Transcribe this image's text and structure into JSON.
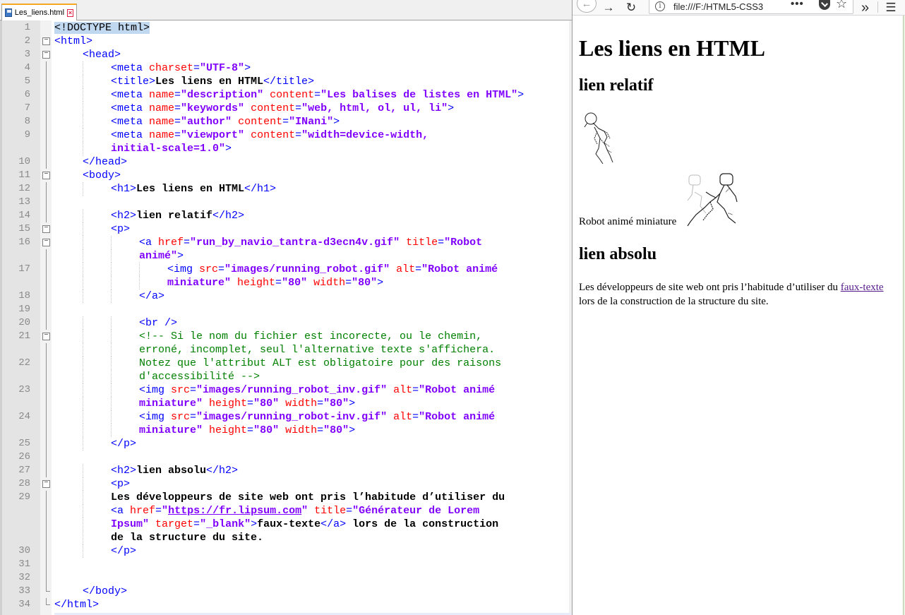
{
  "editor": {
    "tab_title": "Les_liens.html",
    "lines": [
      {
        "n": "1",
        "indent": 0,
        "fold": "",
        "segs": [
          [
            "dt",
            "<!DOCTYPE html>"
          ]
        ]
      },
      {
        "n": "2",
        "indent": 0,
        "fold": "minus",
        "segs": [
          [
            "tg",
            "<html>"
          ]
        ]
      },
      {
        "n": "3",
        "indent": 1,
        "fold": "minus",
        "segs": [
          [
            "tg",
            "<head>"
          ]
        ]
      },
      {
        "n": "4",
        "indent": 2,
        "fold": "line",
        "segs": [
          [
            "tg",
            "<meta "
          ],
          [
            "at",
            "charset"
          ],
          [
            "tg",
            "="
          ],
          [
            "av",
            "\"UTF-8\""
          ],
          [
            "tg",
            ">"
          ]
        ]
      },
      {
        "n": "5",
        "indent": 2,
        "fold": "line",
        "segs": [
          [
            "tg",
            "<title>"
          ],
          [
            "tx",
            "Les liens en HTML"
          ],
          [
            "tg",
            "</title>"
          ]
        ]
      },
      {
        "n": "6",
        "indent": 2,
        "fold": "line",
        "segs": [
          [
            "tg",
            "<meta "
          ],
          [
            "at",
            "name"
          ],
          [
            "tg",
            "="
          ],
          [
            "av",
            "\"description\""
          ],
          [
            "tg",
            " "
          ],
          [
            "at",
            "content"
          ],
          [
            "tg",
            "="
          ],
          [
            "av",
            "\"Les balises de listes en HTML\""
          ],
          [
            "tg",
            ">"
          ]
        ]
      },
      {
        "n": "7",
        "indent": 2,
        "fold": "line",
        "segs": [
          [
            "tg",
            "<meta "
          ],
          [
            "at",
            "name"
          ],
          [
            "tg",
            "="
          ],
          [
            "av",
            "\"keywords\""
          ],
          [
            "tg",
            " "
          ],
          [
            "at",
            "content"
          ],
          [
            "tg",
            "="
          ],
          [
            "av",
            "\"web, html, ol, ul, li\""
          ],
          [
            "tg",
            ">"
          ]
        ]
      },
      {
        "n": "8",
        "indent": 2,
        "fold": "line",
        "segs": [
          [
            "tg",
            "<meta "
          ],
          [
            "at",
            "name"
          ],
          [
            "tg",
            "="
          ],
          [
            "av",
            "\"author\""
          ],
          [
            "tg",
            " "
          ],
          [
            "at",
            "content"
          ],
          [
            "tg",
            "="
          ],
          [
            "av",
            "\"INani\""
          ],
          [
            "tg",
            ">"
          ]
        ]
      },
      {
        "n": "9",
        "indent": 2,
        "fold": "line",
        "segs": [
          [
            "tg",
            "<meta "
          ],
          [
            "at",
            "name"
          ],
          [
            "tg",
            "="
          ],
          [
            "av",
            "\"viewport\""
          ],
          [
            "tg",
            " "
          ],
          [
            "at",
            "content"
          ],
          [
            "tg",
            "="
          ],
          [
            "av",
            "\"width=device-width,"
          ]
        ]
      },
      {
        "n": "",
        "indent": 2,
        "fold": "line",
        "segs": [
          [
            "av",
            "initial-scale=1.0\""
          ],
          [
            "tg",
            ">"
          ]
        ]
      },
      {
        "n": "10",
        "indent": 1,
        "fold": "line",
        "segs": [
          [
            "tg",
            "</head>"
          ]
        ]
      },
      {
        "n": "11",
        "indent": 1,
        "fold": "minus",
        "segs": [
          [
            "tg",
            "<body>"
          ]
        ]
      },
      {
        "n": "12",
        "indent": 2,
        "fold": "line",
        "segs": [
          [
            "tg",
            "<h1>"
          ],
          [
            "tx",
            "Les liens en HTML"
          ],
          [
            "tg",
            "</h1>"
          ]
        ]
      },
      {
        "n": "13",
        "indent": 0,
        "fold": "line",
        "segs": []
      },
      {
        "n": "14",
        "indent": 2,
        "fold": "line",
        "segs": [
          [
            "tg",
            "<h2>"
          ],
          [
            "tx",
            "lien relatif"
          ],
          [
            "tg",
            "</h2>"
          ]
        ]
      },
      {
        "n": "15",
        "indent": 2,
        "fold": "minus",
        "segs": [
          [
            "tg",
            "<p>"
          ]
        ]
      },
      {
        "n": "16",
        "indent": 3,
        "fold": "minus",
        "segs": [
          [
            "tg",
            "<a "
          ],
          [
            "at",
            "href"
          ],
          [
            "tg",
            "="
          ],
          [
            "av",
            "\"run_by_navio_tantra-d3ecn4v.gif\""
          ],
          [
            "tg",
            " "
          ],
          [
            "at",
            "title"
          ],
          [
            "tg",
            "="
          ],
          [
            "av",
            "\"Robot"
          ]
        ]
      },
      {
        "n": "",
        "indent": 3,
        "fold": "line",
        "segs": [
          [
            "av",
            "animé\""
          ],
          [
            "tg",
            ">"
          ]
        ]
      },
      {
        "n": "17",
        "indent": 4,
        "fold": "line",
        "segs": [
          [
            "tg",
            "<img "
          ],
          [
            "at",
            "src"
          ],
          [
            "tg",
            "="
          ],
          [
            "av",
            "\"images/running_robot.gif\""
          ],
          [
            "tg",
            " "
          ],
          [
            "at",
            "alt"
          ],
          [
            "tg",
            "="
          ],
          [
            "av",
            "\"Robot animé"
          ]
        ]
      },
      {
        "n": "",
        "indent": 4,
        "fold": "line",
        "segs": [
          [
            "av",
            "miniature\""
          ],
          [
            "tg",
            " "
          ],
          [
            "at",
            "height"
          ],
          [
            "tg",
            "="
          ],
          [
            "av",
            "\"80\""
          ],
          [
            "tg",
            " "
          ],
          [
            "at",
            "width"
          ],
          [
            "tg",
            "="
          ],
          [
            "av",
            "\"80\""
          ],
          [
            "tg",
            ">"
          ]
        ]
      },
      {
        "n": "18",
        "indent": 3,
        "fold": "line",
        "segs": [
          [
            "tg",
            "</a>"
          ]
        ]
      },
      {
        "n": "19",
        "indent": 0,
        "fold": "line",
        "segs": []
      },
      {
        "n": "20",
        "indent": 3,
        "fold": "line",
        "segs": [
          [
            "tg",
            "<br />"
          ]
        ]
      },
      {
        "n": "21",
        "indent": 3,
        "fold": "minus",
        "segs": [
          [
            "cm",
            "<!-- Si le nom du fichier est incorecte, ou le chemin,"
          ]
        ]
      },
      {
        "n": "",
        "indent": 3,
        "fold": "line",
        "segs": [
          [
            "cm",
            "erroné, incomplet, seul l'alternative texte s'affichera."
          ]
        ]
      },
      {
        "n": "22",
        "indent": 3,
        "fold": "line",
        "segs": [
          [
            "cm",
            "Notez que l'attribut ALT est obligatoire pour des raisons"
          ]
        ]
      },
      {
        "n": "",
        "indent": 3,
        "fold": "line",
        "segs": [
          [
            "cm",
            "d'accessibilité -->"
          ]
        ]
      },
      {
        "n": "23",
        "indent": 3,
        "fold": "line",
        "segs": [
          [
            "tg",
            "<img "
          ],
          [
            "at",
            "src"
          ],
          [
            "tg",
            "="
          ],
          [
            "av",
            "\"images/running_robot_inv.gif\""
          ],
          [
            "tg",
            " "
          ],
          [
            "at",
            "alt"
          ],
          [
            "tg",
            "="
          ],
          [
            "av",
            "\"Robot animé"
          ]
        ]
      },
      {
        "n": "",
        "indent": 3,
        "fold": "line",
        "segs": [
          [
            "av",
            "miniature\""
          ],
          [
            "tg",
            " "
          ],
          [
            "at",
            "height"
          ],
          [
            "tg",
            "="
          ],
          [
            "av",
            "\"80\""
          ],
          [
            "tg",
            " "
          ],
          [
            "at",
            "width"
          ],
          [
            "tg",
            "="
          ],
          [
            "av",
            "\"80\""
          ],
          [
            "tg",
            ">"
          ]
        ]
      },
      {
        "n": "24",
        "indent": 3,
        "fold": "line",
        "segs": [
          [
            "tg",
            "<img "
          ],
          [
            "at",
            "src"
          ],
          [
            "tg",
            "="
          ],
          [
            "av",
            "\"images/running_robot-inv.gif\""
          ],
          [
            "tg",
            " "
          ],
          [
            "at",
            "alt"
          ],
          [
            "tg",
            "="
          ],
          [
            "av",
            "\"Robot animé"
          ]
        ]
      },
      {
        "n": "",
        "indent": 3,
        "fold": "line",
        "segs": [
          [
            "av",
            "miniature\""
          ],
          [
            "tg",
            " "
          ],
          [
            "at",
            "height"
          ],
          [
            "tg",
            "="
          ],
          [
            "av",
            "\"80\""
          ],
          [
            "tg",
            " "
          ],
          [
            "at",
            "width"
          ],
          [
            "tg",
            "="
          ],
          [
            "av",
            "\"80\""
          ],
          [
            "tg",
            ">"
          ]
        ]
      },
      {
        "n": "25",
        "indent": 2,
        "fold": "line",
        "segs": [
          [
            "tg",
            "</p>"
          ]
        ]
      },
      {
        "n": "26",
        "indent": 0,
        "fold": "line",
        "segs": []
      },
      {
        "n": "27",
        "indent": 2,
        "fold": "line",
        "segs": [
          [
            "tg",
            "<h2>"
          ],
          [
            "tx",
            "lien absolu"
          ],
          [
            "tg",
            "</h2>"
          ]
        ]
      },
      {
        "n": "28",
        "indent": 2,
        "fold": "minus",
        "segs": [
          [
            "tg",
            "<p>"
          ]
        ]
      },
      {
        "n": "29",
        "indent": 2,
        "fold": "line",
        "segs": [
          [
            "tx",
            "Les développeurs de site web ont pris l’habitude d’utiliser du"
          ]
        ]
      },
      {
        "n": "",
        "indent": 2,
        "fold": "line",
        "segs": [
          [
            "tg",
            "<a "
          ],
          [
            "at",
            "href"
          ],
          [
            "tg",
            "="
          ],
          [
            "av",
            "\""
          ],
          [
            "avu",
            "https://fr.lipsum.com"
          ],
          [
            "av",
            "\""
          ],
          [
            "tg",
            " "
          ],
          [
            "at",
            "title"
          ],
          [
            "tg",
            "="
          ],
          [
            "av",
            "\"Générateur de Lorem"
          ]
        ]
      },
      {
        "n": "",
        "indent": 2,
        "fold": "line",
        "segs": [
          [
            "av",
            "Ipsum\""
          ],
          [
            "tg",
            " "
          ],
          [
            "at",
            "target"
          ],
          [
            "tg",
            "="
          ],
          [
            "av",
            "\"_blank\""
          ],
          [
            "tg",
            ">"
          ],
          [
            "tx",
            "faux-texte"
          ],
          [
            "tg",
            "</a>"
          ],
          [
            "tx",
            " lors de la construction"
          ]
        ]
      },
      {
        "n": "",
        "indent": 2,
        "fold": "line",
        "segs": [
          [
            "tx",
            "de la structure du site."
          ]
        ]
      },
      {
        "n": "30",
        "indent": 2,
        "fold": "line",
        "segs": [
          [
            "tg",
            "</p>"
          ]
        ]
      },
      {
        "n": "31",
        "indent": 0,
        "fold": "line",
        "segs": []
      },
      {
        "n": "32",
        "indent": 0,
        "fold": "line",
        "segs": []
      },
      {
        "n": "33",
        "indent": 1,
        "fold": "end",
        "segs": [
          [
            "tg",
            "</body>"
          ]
        ]
      },
      {
        "n": "34",
        "indent": 0,
        "fold": "end",
        "segs": [
          [
            "tg",
            "</html>"
          ]
        ]
      }
    ]
  },
  "browser": {
    "url": "file:///F:/HTML5-CSS3",
    "page": {
      "h1": "Les liens en HTML",
      "h2_relatif": "lien relatif",
      "alt_text": "Robot animé miniature",
      "h2_absolu": "lien absolu",
      "para_before": "Les développeurs de site web ont pris l’habitude d’utiliser du ",
      "link_text": "faux-texte",
      "para_after": " lors de la construction de la structure du site."
    }
  }
}
